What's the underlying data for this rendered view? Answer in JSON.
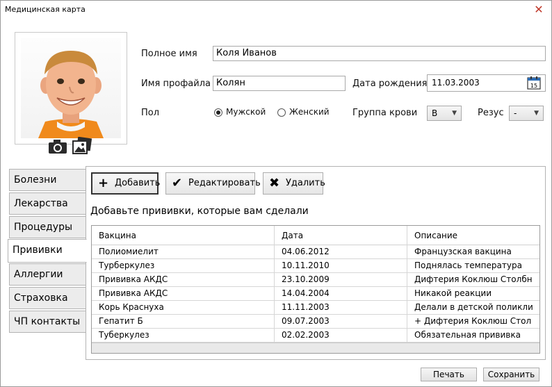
{
  "window": {
    "title": "Медицинская карта",
    "close_glyph": "✕"
  },
  "form": {
    "full_name_label": "Полное имя",
    "full_name_value": "Коля Иванов",
    "profile_name_label": "Имя профайла",
    "profile_name_value": "Колян",
    "birth_date_label": "Дата рождения",
    "birth_date_value": "11.03.2003",
    "calendar_day": "15",
    "gender_label": "Пол",
    "gender_male": "Мужской",
    "gender_female": "Женский",
    "blood_group_label": "Группа крови",
    "blood_group_value": "B",
    "rhesus_label": "Резус",
    "rhesus_value": "-"
  },
  "tabs": [
    {
      "label": "Болезни"
    },
    {
      "label": "Лекарства"
    },
    {
      "label": "Процедуры"
    },
    {
      "label": "Прививки"
    },
    {
      "label": "Аллергии"
    },
    {
      "label": "Страховка"
    },
    {
      "label": "ЧП контакты"
    }
  ],
  "toolbar": {
    "add_label": "Добавить",
    "edit_label": "Редактировать",
    "delete_label": "Удалить"
  },
  "vaccinations": {
    "hint": "Добавьте прививки, которые вам сделали",
    "columns": [
      "Вакцина",
      "Дата",
      "Описание"
    ],
    "rows": [
      [
        "Полиомиелит",
        "04.06.2012",
        "Французская вакцина"
      ],
      [
        "Турберкулез",
        "10.11.2010",
        "Поднялась температура"
      ],
      [
        "Прививка АКДС",
        "23.10.2009",
        "Дифтерия Коклюш Столбн"
      ],
      [
        "Прививка АКДС",
        "14.04.2004",
        "Никакой реакции"
      ],
      [
        "Корь Краснуха",
        "11.11.2003",
        "Делали в детской поликли"
      ],
      [
        "Гепатит Б",
        "09.07.2003",
        "+ Дифтерия Коклюш Стол"
      ],
      [
        "Туберкулез",
        "02.02.2003",
        "Обязательная прививка"
      ]
    ]
  },
  "footer": {
    "print_label": "Печать",
    "save_label": "Сохранить"
  }
}
